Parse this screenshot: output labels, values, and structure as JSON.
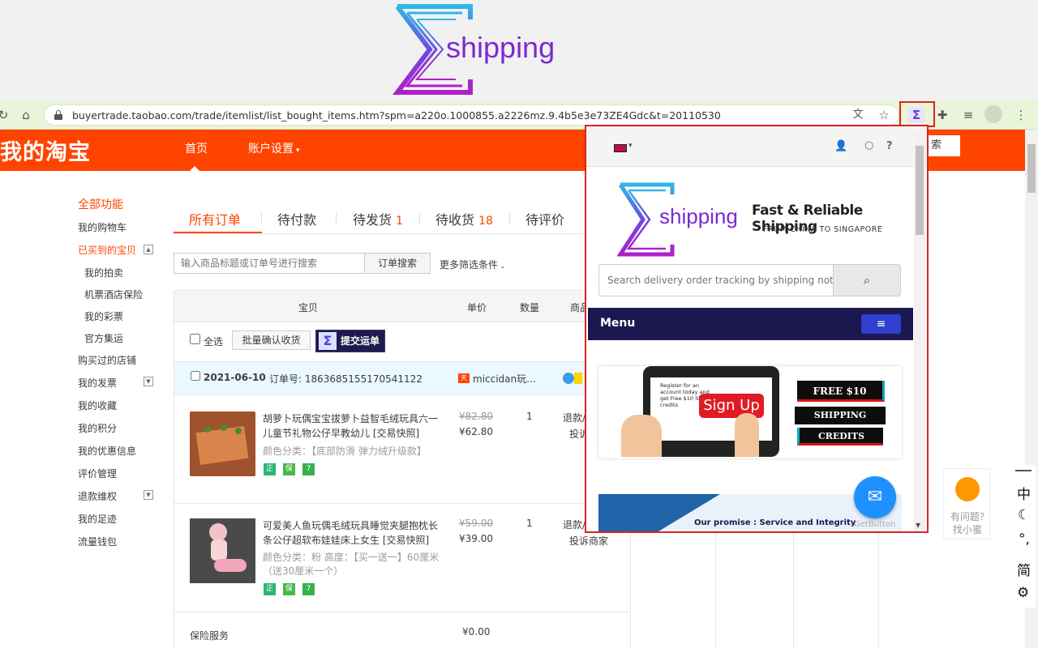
{
  "banner": {
    "brand": "shipping"
  },
  "browser": {
    "url": "buyertrade.taobao.com/trade/itemlist/list_bought_items.htm?spm=a220o.1000855.a2226mz.9.4b5e3e73ZE4Gdc&t=20110530"
  },
  "header": {
    "title": "我的淘宝",
    "nav": [
      "首页",
      "账户设置"
    ],
    "search_label": "索"
  },
  "sidebar": {
    "items": [
      "全部功能",
      "我的购物车",
      "已买到的宝贝",
      "我的拍卖",
      "机票酒店保险",
      "我的彩票",
      "官方集运",
      "购买过的店铺",
      "我的发票",
      "我的收藏",
      "我的积分",
      "我的优惠信息",
      "评价管理",
      "退款维权",
      "我的足迹",
      "流量钱包"
    ]
  },
  "tabs": [
    {
      "label": "所有订单",
      "count": ""
    },
    {
      "label": "待付款",
      "count": ""
    },
    {
      "label": "待发货",
      "count": "1"
    },
    {
      "label": "待收货",
      "count": "18"
    },
    {
      "label": "待评价",
      "count": ""
    }
  ],
  "search": {
    "placeholder": "输入商品标题或订单号进行搜索",
    "button": "订单搜索",
    "more": "更多筛选条件"
  },
  "table": {
    "headers": [
      "宝贝",
      "单价",
      "数量",
      "商品"
    ],
    "select_all": "全选",
    "batch_confirm": "批量确认收货",
    "submit_waybill": "提交运单",
    "order": {
      "date": "2021-06-10",
      "order_no": "订单号: 1863685155170541122",
      "shop": "miccidan玩..."
    },
    "items": [
      {
        "title": "胡萝卜玩偶宝宝拔萝卜益智毛绒玩具六一儿童节礼物公仔早教幼儿 [交易快照]",
        "variant": "颜色分类：【底部防滑 弹力绒升级款】",
        "orig_price": "¥82.80",
        "price": "¥62.80",
        "qty": "1",
        "action1": "退款/",
        "action2": "投诉"
      },
      {
        "title": "可爱美人鱼玩偶毛绒玩具睡觉夹腿抱枕长条公仔超软布娃娃床上女生 [交易快照]",
        "variant": "颜色分类：粉  高度：【买一送一】60厘米（送30厘米一个）",
        "orig_price": "¥59.00",
        "price": "¥39.00",
        "qty": "1",
        "action1": "退款/",
        "action2": "投诉商家"
      }
    ],
    "insurance_label": "保险服务",
    "insurance_price": "¥0.00"
  },
  "popup": {
    "brand": "shipping",
    "tagline": "Fast & Reliable Shipping",
    "subtagline": "FROM CHINA TO SINGAPORE",
    "search_placeholder": "Search delivery order tracking by shipping note number",
    "menu": "Menu",
    "promo": {
      "phone_text": "Register for an account today and get Free $10 Shipping credits",
      "signup": "Sign Up",
      "free": "FREE $10",
      "shipping": "SHIPPING",
      "credits": "CREDITS"
    },
    "promise": "Our promise : Service and Integrity",
    "getbutton": "GetButton"
  },
  "helper": {
    "line1": "有问题?",
    "line2": "找小蜜"
  },
  "ime": [
    "中",
    "简"
  ]
}
